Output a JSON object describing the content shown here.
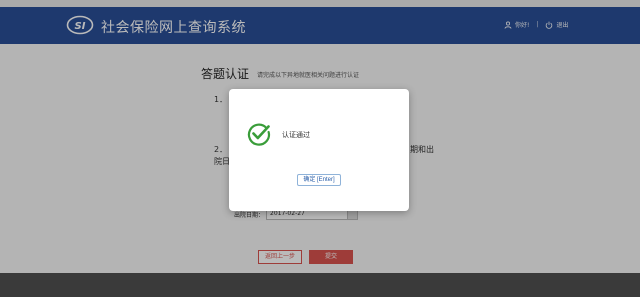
{
  "header": {
    "title": "社会保险网上查询系统",
    "user_name": "你好!",
    "logout": "退出"
  },
  "page": {
    "section_title": "答题认证",
    "section_subtitle": "请完成以下异地就医相关问题进行认证",
    "q1_num": "1．",
    "q2_num": "2．",
    "q2_tail": "期和出",
    "q2_line2": "院日",
    "date_label": "出院日期：",
    "date_value": "2017-02-27",
    "back_button": "返回上一步",
    "submit_button": "提交"
  },
  "modal": {
    "message": "认证通过",
    "confirm_button": "确定 [Enter]"
  },
  "colors": {
    "header_bg": "#2a4f97",
    "accent_red": "#d9534f",
    "success_green": "#3a9d3a"
  }
}
